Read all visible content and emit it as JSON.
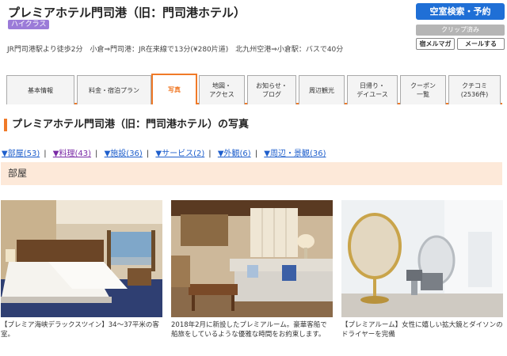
{
  "hotel": {
    "title": "プレミアホテル門司港（旧：門司港ホテル）",
    "class_badge": "ハイクラス",
    "access": "JR門司港駅より徒歩2分　小倉⇒門司港：JR在来線で13分(¥280片道)　北九州空港⇒小倉駅：バスで40分"
  },
  "actions": {
    "reserve_label": "空室検索・予約",
    "clip_label": "クリップ済み",
    "mailmag_label": "宿メルマガ",
    "mail_label": "メールする"
  },
  "tabs": [
    {
      "label": "基本情報"
    },
    {
      "label": "料金・宿泊プラン"
    },
    {
      "label": "写真"
    },
    {
      "label": "地図・\nアクセス"
    },
    {
      "label": "お知らせ・\nブログ"
    },
    {
      "label": "周辺観光"
    },
    {
      "label": "日帰り・\nデイユース"
    },
    {
      "label": "クーポン\n一覧"
    },
    {
      "label": "クチコミ\n(2536件)"
    }
  ],
  "photo_section": {
    "heading": "プレミアホテル門司港（旧：門司港ホテル）の写真"
  },
  "anchors": [
    {
      "label": "▼部屋",
      "count": "(53)"
    },
    {
      "label": "▼料理",
      "count": "(43)"
    },
    {
      "label": "▼施設",
      "count": "(36)"
    },
    {
      "label": "▼サービス",
      "count": "(2)"
    },
    {
      "label": "▼外観",
      "count": "(6)"
    },
    {
      "label": "▼周辺・景観",
      "count": "(36)"
    }
  ],
  "category": {
    "title": "部屋"
  },
  "photos": [
    {
      "caption": "【プレミア海峡デラックスツイン】34～37平米の客室。"
    },
    {
      "caption": "2018年2月に新設したプレミアルーム。豪華客船で船旅をしているような優雅な時間をお約束します。"
    },
    {
      "caption": "【プレミアルーム】女性に嬉しい拡大鏡とダイソンのドライヤーを完備"
    }
  ],
  "colors": {
    "accent": "#f07a28",
    "reserve_button": "#1f6fd6",
    "badge": "#9b7bd8",
    "category_bg": "#fde9d9",
    "link": "#1f5fcc",
    "visited_link": "#7a2aa6"
  }
}
